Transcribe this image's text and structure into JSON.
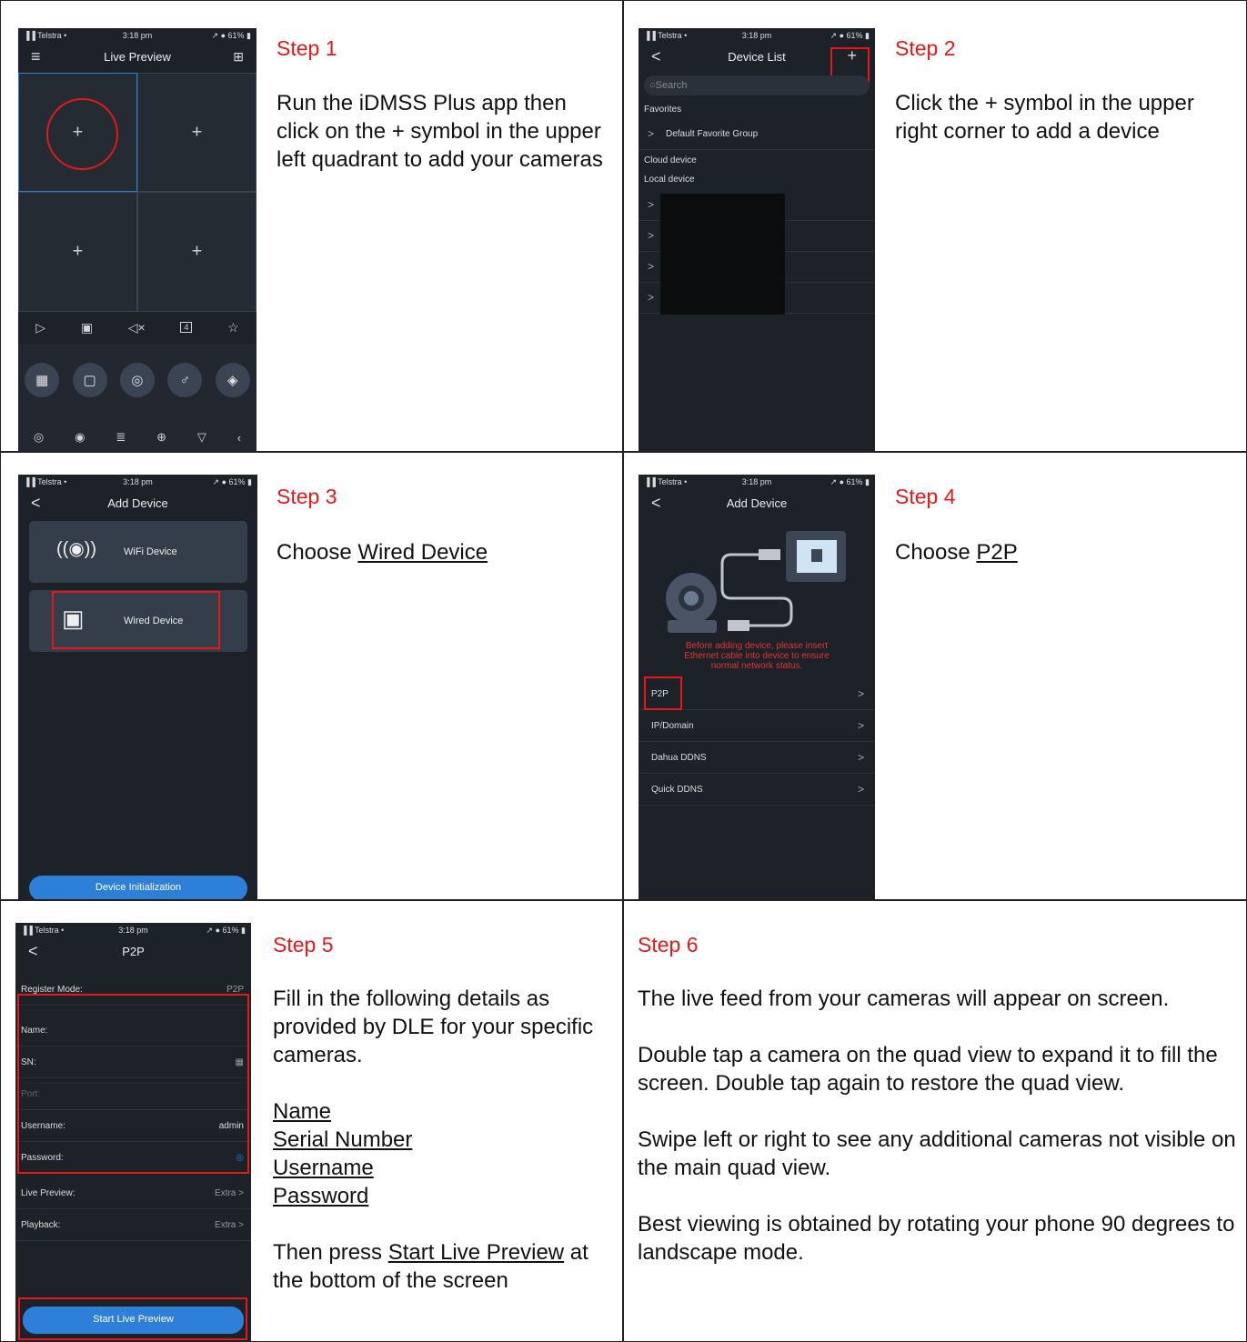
{
  "steps": [
    {
      "title": "Step 1",
      "text": [
        "Run the iDMSS Plus app then click on the + symbol in the upper left quadrant to add your cameras"
      ]
    },
    {
      "title": "Step 2",
      "text": [
        "Click the + symbol in the upper right corner to add a device"
      ]
    },
    {
      "title": "Step 3",
      "prefix": "Choose ",
      "link": "Wired Device"
    },
    {
      "title": "Step 4",
      "prefix": "Choose ",
      "link": "P2P"
    },
    {
      "title": "Step 5",
      "intro": "Fill in the following details as provided by DLE for your specific cameras.",
      "fields": [
        "Name",
        "Serial Number",
        "Username",
        "Password"
      ],
      "outro_prefix": "Then press ",
      "outro_link": "Start Live Preview",
      "outro_suffix": " at the bottom of the screen"
    },
    {
      "title": "Step 6",
      "paragraphs": [
        "The live feed from your cameras will appear on screen.",
        "Double tap a camera on the quad view to expand it to fill the screen.  Double tap again to restore the quad view.",
        "Swipe left or right to see any additional cameras not visible on the main quad view.",
        "Best viewing is obtained by rotating your phone 90 degrees to landscape mode."
      ]
    }
  ],
  "status": {
    "carrier": "▐▐ Telstra •",
    "time": "3:18 pm",
    "battery": "↗ ● 61% ▮"
  },
  "screen1": {
    "title": "Live Preview",
    "menu_icon": "≡",
    "right_icon": "⊞",
    "plus": "+",
    "toolbar": [
      "▷",
      "▣",
      "◁×",
      "4",
      "☆"
    ],
    "big_buttons": [
      "▦",
      "▢",
      "◎",
      "♂",
      "◈"
    ],
    "bottom_icons": [
      "◎",
      "◉",
      "≣",
      "⊕",
      "▽",
      "‹"
    ]
  },
  "screen2": {
    "title": "Device List",
    "back": "<",
    "add": "+",
    "search_placeholder": "○Search",
    "favorites": "Favorites",
    "default_group": "Default Favorite Group",
    "cloud": "Cloud device",
    "local": "Local device",
    "chev": ">"
  },
  "screen3": {
    "title": "Add Device",
    "back": "<",
    "wifi": "WiFi Device",
    "wired": "Wired Device",
    "wifi_icon": "((◉))",
    "wired_icon": "▣",
    "init_button": "Device Initialization"
  },
  "screen4": {
    "title": "Add Device",
    "back": "<",
    "warning": [
      "Before adding device, please insert",
      "Ethernet cable into device to ensure",
      "normal network status."
    ],
    "options": [
      "P2P",
      "IP/Domain",
      "Dahua DDNS",
      "Quick DDNS"
    ],
    "chev": ">"
  },
  "screen5": {
    "title": "P2P",
    "back": "<",
    "register_mode_label": "Register Mode:",
    "register_mode_value": "P2P",
    "fields": [
      {
        "label": "Name:",
        "value": ""
      },
      {
        "label": "SN:",
        "value": "▦"
      },
      {
        "label": "Port:",
        "value": ""
      },
      {
        "label": "Username:",
        "value": "admin"
      },
      {
        "label": "Password:",
        "value": "◎"
      }
    ],
    "live_preview_label": "Live Preview:",
    "live_preview_value": "Extra >",
    "playback_label": "Playback:",
    "playback_value": "Extra >",
    "start_button": "Start Live Preview"
  }
}
